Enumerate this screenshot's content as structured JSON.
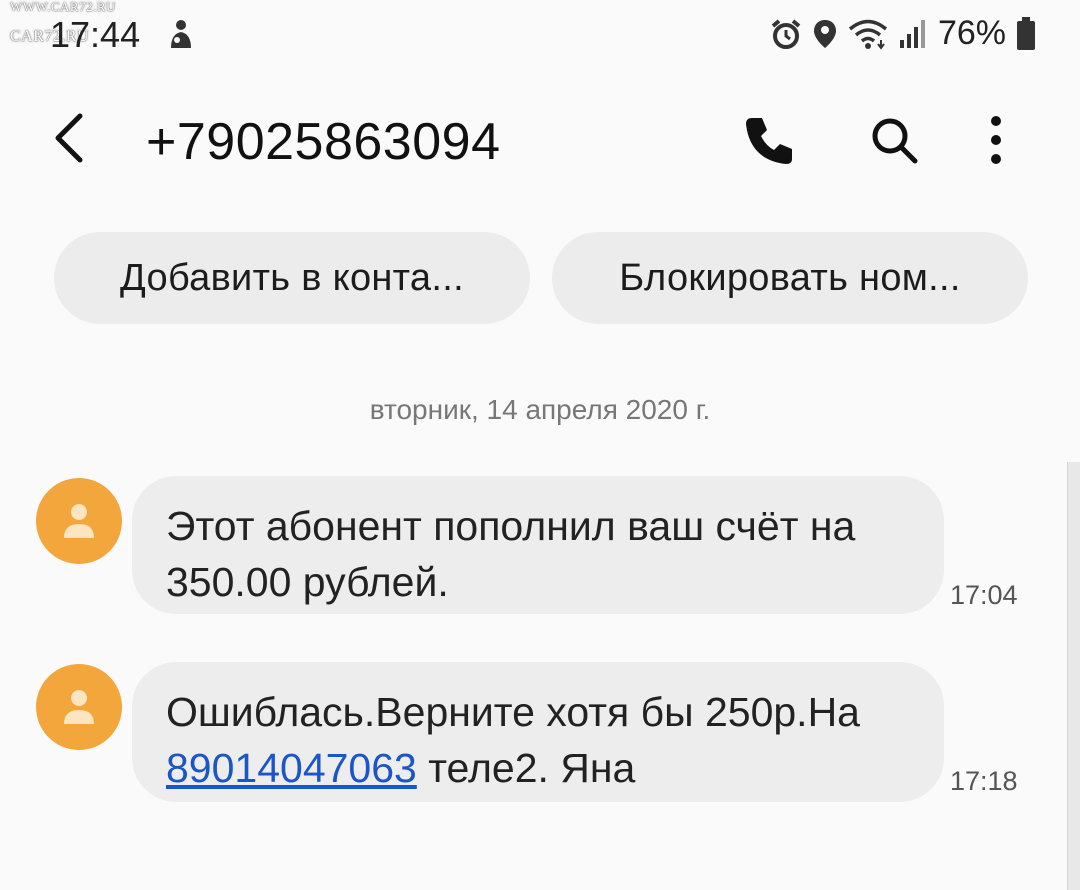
{
  "watermark": {
    "line1": "WWW.CAR72.RU",
    "line2": "CAR72.RU"
  },
  "status_bar": {
    "time": "17:44",
    "battery": "76%",
    "icons": [
      "person-icon",
      "alarm-icon",
      "location-icon",
      "wifi-icon",
      "signal-icon",
      "battery-icon"
    ]
  },
  "header": {
    "title": "+79025863094",
    "icons": [
      "back-arrow-icon",
      "phone-icon",
      "search-icon",
      "more-vert-icon"
    ]
  },
  "actions": {
    "add_contact": "Добавить в конта...",
    "block_number": "Блокировать ном..."
  },
  "conversation": {
    "date": "вторник, 14 апреля 2020 г.",
    "messages": [
      {
        "text": "Этот абонент пополнил ваш счёт на 350.00 рублей.",
        "time": "17:04"
      },
      {
        "text_before": "Ошиблась.Верните хотя бы 250р.На ",
        "link": "89014047063",
        "text_after": " теле2. Яна",
        "time": "17:18"
      }
    ]
  },
  "colors": {
    "avatar": "#f2a63c",
    "bubble": "#ededed",
    "chip": "#ececec",
    "link": "#1a55c9"
  }
}
